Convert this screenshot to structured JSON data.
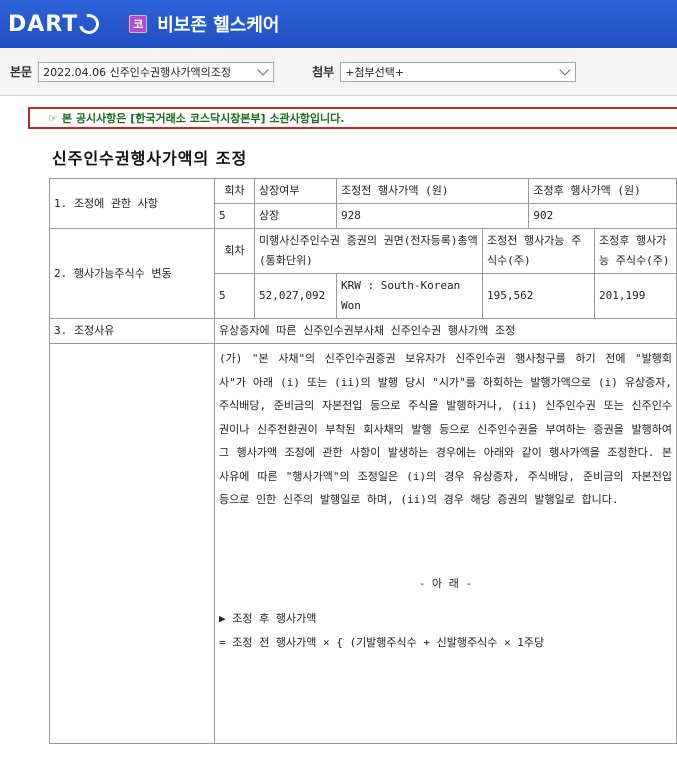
{
  "header": {
    "logo": "DART",
    "company_badge": "코",
    "company_name": "비보존 헬스케어"
  },
  "selectors": {
    "main_label": "본문",
    "main_value": "2022.04.06  신주인수권행사가액의조정",
    "attach_label": "첨부",
    "attach_value": "+첨부선택+"
  },
  "notice": "본 공시사항은 [한국거래소 코스닥시장본부] 소관사항입니다.",
  "doc_title": "신주인수권행사가액의 조정",
  "table": {
    "s1_label": "1. 조정에 관한 사항",
    "s1_h_round": "회차",
    "s1_h_listed": "상장여부",
    "s1_h_before": "조정전 행사가액 (원)",
    "s1_h_after": "조정후 행사가액 (원)",
    "s1_v_round": "5",
    "s1_v_listed": "상장",
    "s1_v_before": "928",
    "s1_v_after": "902",
    "s2_label": "2. 행사가능주식수 변동",
    "s2_h_round": "회차",
    "s2_h_face": "미행사신주인수권 증권의 권면(전자등록)총액 (통화단위)",
    "s2_h_before": "조정전 행사가능 주식수(주)",
    "s2_h_after": "조정후 행사가능 주식수(주)",
    "s2_v_round": "5",
    "s2_v_amount": "52,027,092",
    "s2_v_currency": "KRW : South-Korean Won",
    "s2_v_before": "195,562",
    "s2_v_after": "201,199",
    "s3_label": "3. 조정사유",
    "s3_value": "유상증자에 따른 신주인수권부사채 신주인수권 행사가액 조정",
    "body_para": "(가) \"본 사채\"의 신주인수권증권 보유자가 신주인수권 행사청구를 하기 전에 \"발행회사\"가 아래 (i) 또는 (ii)의 발행 당시 \"시가\"를 하회하는 발행가액으로 (i) 유상증자, 주식배당, 준비금의 자본전입 등으로 주식을 발행하거나, (ii) 신주인수권 또는 신주인수권이나 신주전환권이 부착된 회사채의 발행 등으로 신주인수권을 부여하는 증권을 발행하여 그 행사가액 조정에 관한 사항이 발생하는 경우에는 아래와 같이 행사가액을 조정한다. 본 사유에 따른 \"행사가액\"의 조정일은 (i)의 경우 유상증자, 주식배당, 준비금의 자본전입 등으로 인한 신주의 발행일로 하며, (ii)의 경우 해당 증권의 발행일로 합니다.",
    "below_mark": "- 아  래 -",
    "formula_title": "▶ 조정 후 행사가액",
    "formula_line": "= 조정 전 행사가액 × { (기발행주식수 + 신발행주식수 × 1주당"
  }
}
